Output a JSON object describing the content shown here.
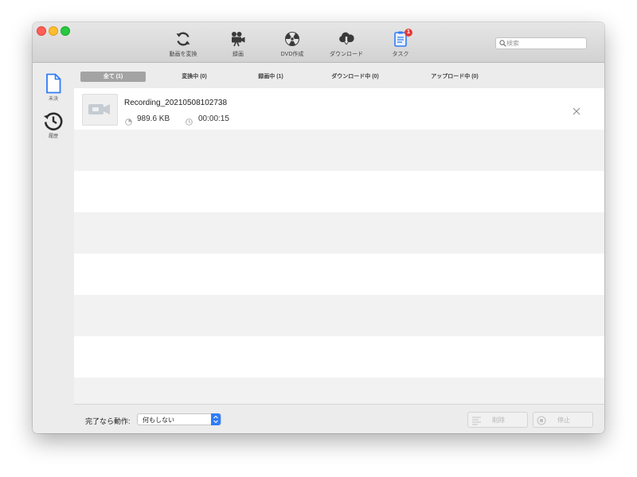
{
  "toolbar": {
    "items": [
      {
        "label": "動画を変換",
        "icon": "convert-icon"
      },
      {
        "label": "録画",
        "icon": "video-camera-icon"
      },
      {
        "label": "DVD作成",
        "icon": "disc-icon"
      },
      {
        "label": "ダウンロード",
        "icon": "cloud-download-icon"
      },
      {
        "label": "タスク",
        "icon": "clipboard-icon",
        "badge": "1"
      }
    ]
  },
  "search": {
    "placeholder": "検索",
    "value": ""
  },
  "sidebar": {
    "items": [
      {
        "label": "未決",
        "icon": "document-icon",
        "selected": true
      },
      {
        "label": "履歴",
        "icon": "history-icon",
        "selected": false
      }
    ]
  },
  "tabs": [
    {
      "label": "全て (1)",
      "active": true
    },
    {
      "label": "変換中 (0)",
      "active": false
    },
    {
      "label": "録画中 (1)",
      "active": false
    },
    {
      "label": "ダウンロード中 (0)",
      "active": false
    },
    {
      "label": "アップロード中 (0)",
      "active": false
    }
  ],
  "tasks": [
    {
      "name": "Recording_20210508102738",
      "size": "989.6 KB",
      "duration": "00:00:15",
      "thumbnail_icon": "video-camera-icon"
    }
  ],
  "bottom": {
    "completion_label": "完了なら動作:",
    "completion_select_value": "何もしない",
    "delete_label": "削除",
    "stop_label": "停止"
  },
  "colors": {
    "accent": "#2f7cf6",
    "badge": "#e53935",
    "active_tab": "#a3a3a3"
  }
}
